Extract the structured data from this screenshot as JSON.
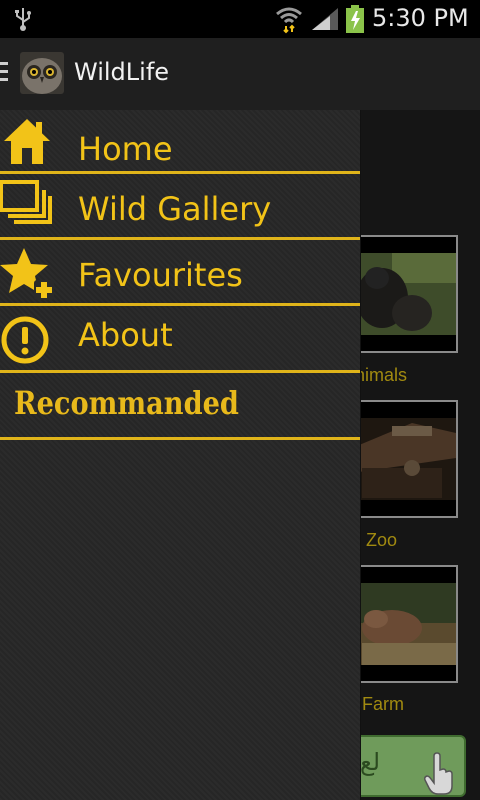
{
  "status_bar": {
    "time": "5:30 PM",
    "icons": [
      "usb-icon",
      "wifi-icon",
      "signal-icon",
      "battery-charging-icon"
    ]
  },
  "action_bar": {
    "title": "WildLife",
    "icons": [
      "drawer-menu-icon",
      "owl-app-icon"
    ]
  },
  "drawer": {
    "items": [
      {
        "label": "Home",
        "icon": "home-icon"
      },
      {
        "label": "Wild Gallery",
        "icon": "gallery-icon"
      },
      {
        "label": "Favourites",
        "icon": "star-plus-icon"
      },
      {
        "label": "About",
        "icon": "info-exclamation-icon"
      }
    ],
    "section_label": "Recommanded"
  },
  "background_list": {
    "captions": [
      "nimals",
      "Zoo",
      "Farm"
    ],
    "button_text": "لع"
  },
  "colors": {
    "accent": "#F2C318",
    "drawer_bg": "#2A2A2A",
    "actionbar_bg": "#1F1F1F",
    "caption": "#A18A10"
  }
}
